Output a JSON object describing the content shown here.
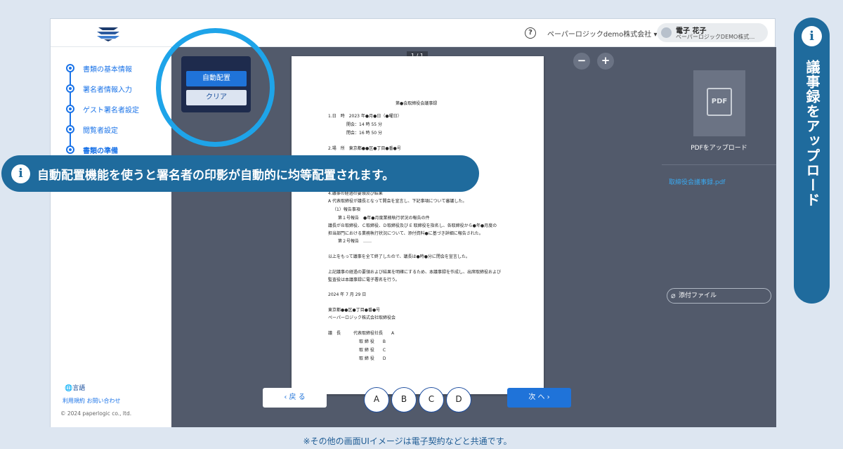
{
  "header": {
    "help_icon": "?",
    "company_menu": "ペーパーロジックdemo株式会社 ▾",
    "user_name": "電子 花子",
    "user_org": "ペーパーロジックDEMO株式…"
  },
  "sidebar": {
    "steps": [
      {
        "label": "書類の基本情報"
      },
      {
        "label": "署名者情報入力"
      },
      {
        "label": "ゲスト署名者設定"
      },
      {
        "label": "閲覧者設定"
      },
      {
        "label": "書類の準備"
      }
    ],
    "language": "言語",
    "links": "利用規約  お問い合わせ",
    "copyright": "© 2024 paperlogic co., ltd."
  },
  "popup": {
    "auto_place": "自動配置",
    "clear": "クリア"
  },
  "viewer": {
    "page_indicator": "1 / 1",
    "zoom_out": "−",
    "zoom_in": "+",
    "back": "‹   戻 る",
    "next": "次 へ   ›",
    "signers": [
      "A",
      "B",
      "C",
      "D"
    ]
  },
  "document": {
    "lines": [
      "第●会取締役会議事録",
      "1.日　時　2023 年●月●日（●曜日）",
      "開会：14 時 55 分",
      "閉会：16 時 50 分",
      "2.場　所　東京都●●区●丁目●番●号",
      "4.議事の経過の要領及び結果",
      "A 代表取締役が議長となって開会を宣言し、下記事項について審議した。",
      "（1）報告事項",
      "第１号報告　●年●月度業務執行状況の報告の件",
      "議長がＢ取締役、Ｃ取締役、Ｄ取締役及び E 取締役を指名し、各取締役から●年●月度の",
      "担当部門における業務執行状況について、添付資料●に基づき詳細に報告された。",
      "第２号報告　……",
      "以上をもって議事を全て終了したので、議長は●時●分に閉会を宣言した。",
      "上記議事の経過の要領および結果を明確にするため、本議事録を作成し、出席取締役および",
      "監査役は本議事録に電子署名を行う。",
      "2024 年 7 月 29 日",
      "東京都●●区●丁目●番●号",
      "ペーパーロジック株式会社取締役会",
      "議　長　　　代表取締役社長　　A",
      "取 締 役　　B",
      "取 締 役　　C",
      "取 締 役　　D"
    ]
  },
  "right_panel": {
    "pdf_icon": "PDF",
    "upload_label": "PDFをアップロード",
    "file_name": "取締役会議事録.pdf",
    "attach_label": "添付ファイル"
  },
  "callout": {
    "icon": "i",
    "text": "自動配置機能を使うと署名者の印影が自動的に均等配置されます。"
  },
  "vertical_banner": {
    "icon": "i",
    "text": "議事録をアップロード"
  },
  "footnote": "※その他の画面UIイメージは電子契約などと共通です。",
  "colors": {
    "accent": "#1f73d9",
    "banner": "#1f6b9d",
    "ring": "#1ea4e9",
    "viewer_bg": "#525a6b"
  }
}
